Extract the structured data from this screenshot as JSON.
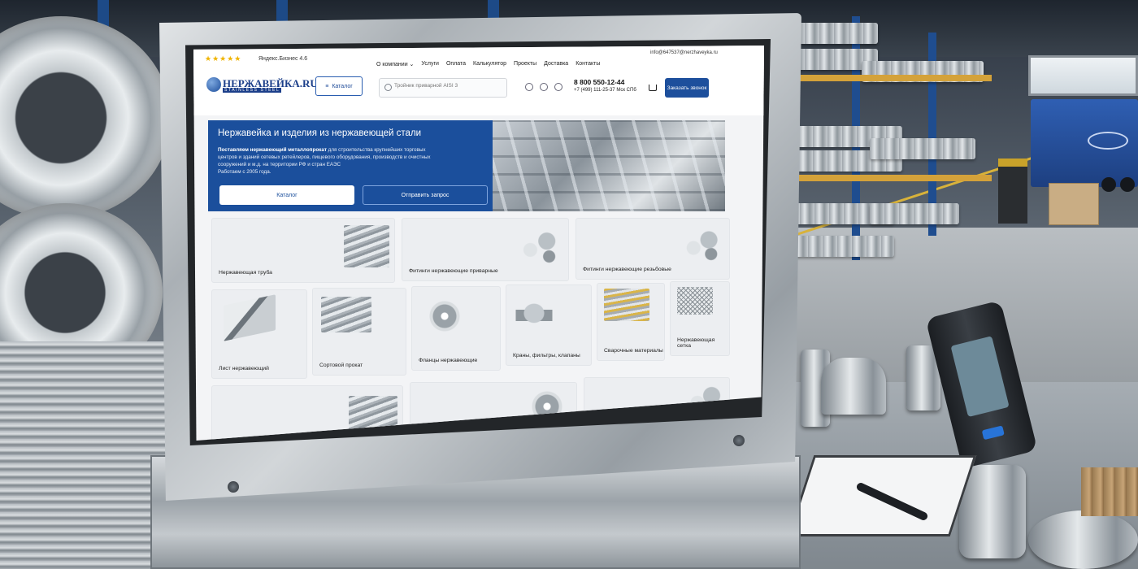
{
  "site": {
    "rating_stars": "★★★★★",
    "rating_text": "Яндекс.Бизнес 4.6",
    "nav": [
      "О компании ⌄",
      "Услуги",
      "Оплата",
      "Калькулятор",
      "Проекты",
      "Доставка",
      "Контакты"
    ],
    "email": "info@647537@nerzhaveyka.ru",
    "logo_title": "НЕРЖАВЕЙКА.RU",
    "logo_subtitle": "STAINLESS STEEL",
    "catalog_button": "Каталог",
    "search_placeholder": "Тройник приварной AISI 3",
    "phone_main": "8 800 550-12-44",
    "phone_secondary": "+7 (499) 111-25-37   Мск   СПб",
    "call_button": "Заказать звонок"
  },
  "hero": {
    "title": "Нержавейка и изделия из нержавеющей стали",
    "desc_bold": "Поставляем нержавеющий металлопрокат",
    "desc_rest": " для строительства крупнейших торговых центров и зданий сетевых ретейлеров, пищевого оборудования, производств и очистных сооружений и м.д. на территории РФ и стран ЕАЭС",
    "desc_since": "Работаем с 2005 года.",
    "btn_catalog": "Каталог",
    "btn_request": "Отправить запрос"
  },
  "categories": [
    "Нержавеющая труба",
    "Фитинги нержавеющие приварные",
    "Фитинги нержавеющие резьбовые",
    "Лист нержавеющий",
    "Сортовой прокат",
    "Фланцы нержавеющие",
    "Краны, фильтры, клапаны",
    "Сварочные материалы",
    "Нержавеющая сетка"
  ],
  "colors": {
    "brand_blue": "#1b4f9c",
    "rating_star": "#f0b400",
    "rack_blue": "#1f4d8f",
    "rack_orange": "#d4a23a"
  },
  "icons": [
    "search-icon",
    "telegram-icon",
    "whatsapp-icon",
    "max-icon",
    "cart-icon",
    "menu-icon"
  ]
}
